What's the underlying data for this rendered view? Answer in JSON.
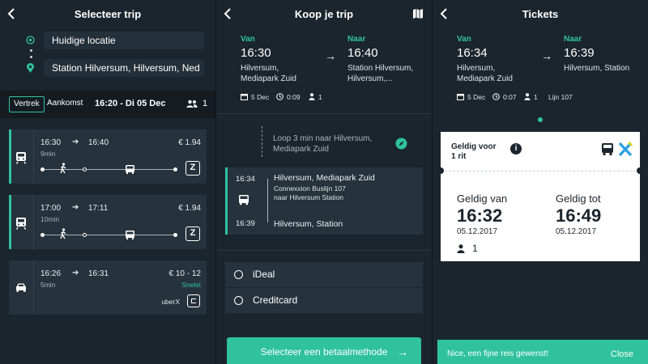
{
  "colors": {
    "accent": "#2fc29d",
    "background": "#1b252d",
    "card": "#26333c"
  },
  "screen1": {
    "title": "Selecteer trip",
    "from": "Huidige locatie",
    "to": "Station Hilversum, Hilversum, Ned",
    "departure_tab": "Vertrek",
    "arrival_tab": "Aankomst",
    "when": "16:20 - Di 05 Dec",
    "passengers": "1",
    "trips": [
      {
        "mode_icon": "train-icon",
        "dep": "16:30",
        "arr": "16:40",
        "duration": "9min",
        "price": "€ 1.94"
      },
      {
        "mode_icon": "train-icon",
        "dep": "17:00",
        "arr": "17:11",
        "duration": "10min",
        "price": "€ 1.94"
      },
      {
        "mode_icon": "car-icon",
        "dep": "16:26",
        "arr": "16:31",
        "duration": "5min",
        "price": "€ 10 - 12",
        "tag": "Snelst",
        "provider": "uberX"
      }
    ]
  },
  "screen2": {
    "title": "Koop je trip",
    "from_label": "Van",
    "to_label": "Naar",
    "dep_time": "16:30",
    "arr_time": "16:40",
    "from_place_1": "Hilversum,",
    "from_place_2": "Mediapark Zuid",
    "to_place_1": "Station Hilversum,",
    "to_place_2": "Hilversum,...",
    "date": "5 Dec",
    "duration": "0:09",
    "passengers": "1",
    "walk_1": "Loop 3 min naar Hilversum,",
    "walk_2": "Mediapark Zuid",
    "leg_dep": "16:34",
    "leg_arr": "16:39",
    "leg_stop_from": "Hilversum, Mediapark Zuid",
    "leg_line": "Connexxion Buslijn 107",
    "leg_direction": "naar Hilversum Station",
    "leg_stop_to": "Hilversum, Station",
    "payments": [
      "iDeal",
      "Creditcard"
    ],
    "cta": "Selecteer een betaalmethode"
  },
  "screen3": {
    "title": "Tickets",
    "from_label": "Van",
    "to_label": "Naar",
    "dep_time": "16:34",
    "arr_time": "16:39",
    "from_place_1": "Hilversum,",
    "from_place_2": "Mediapark Zuid",
    "to_place_1": "Hilversum, Station",
    "date": "5 Dec",
    "duration": "0:07",
    "passengers": "1",
    "line": "Lijn 107",
    "ticket": {
      "valid_for_1": "Geldig voor",
      "valid_for_2": "1 rit",
      "valid_from_label": "Geldig van",
      "valid_from_time": "16:32",
      "valid_from_date": "05.12.2017",
      "valid_to_label": "Geldig tot",
      "valid_to_time": "16:49",
      "valid_to_date": "05.12.2017",
      "passengers": "1"
    },
    "toast": "Nice, een fijne reis gewenst!",
    "close": "Close"
  }
}
